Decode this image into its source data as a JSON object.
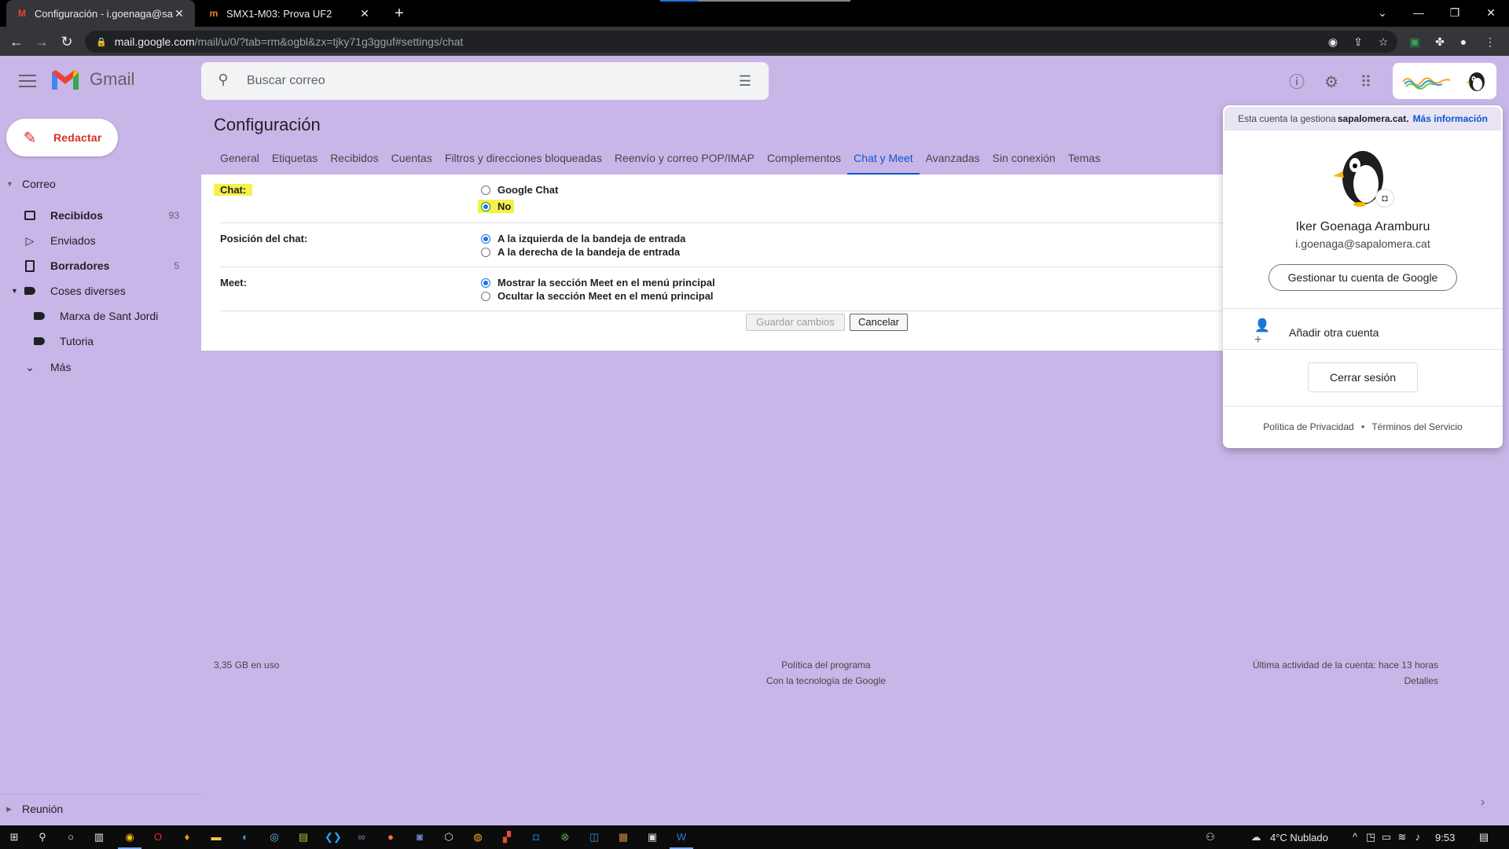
{
  "browser": {
    "tabs": [
      {
        "title": "Configuración - i.goenaga@sapa",
        "active": true
      },
      {
        "title": "SMX1-M03: Prova UF2",
        "active": false
      }
    ],
    "url_host": "mail.google.com",
    "url_path": "/mail/u/0/?tab=rm&ogbl&zx=tjky71g3gguf#settings/chat"
  },
  "gmail": {
    "wordmark": "Gmail",
    "search_placeholder": "Buscar correo"
  },
  "sidebar": {
    "compose": "Redactar",
    "section_mail": "Correo",
    "items": [
      {
        "label": "Recibidos",
        "count": "93",
        "icon": "inbox-icon",
        "bold": true
      },
      {
        "label": "Enviados",
        "count": "",
        "icon": "send-icon",
        "bold": false
      },
      {
        "label": "Borradores",
        "count": "5",
        "icon": "draft-icon",
        "bold": true
      },
      {
        "label": "Coses diverses",
        "count": "",
        "icon": "label-icon",
        "bold": false
      },
      {
        "label": "Marxa de Sant Jordi",
        "count": "",
        "icon": "label-icon",
        "bold": false
      },
      {
        "label": "Tutoria",
        "count": "",
        "icon": "label-icon",
        "bold": false
      },
      {
        "label": "Más",
        "count": "",
        "icon": "chevron-down-icon",
        "bold": false
      }
    ],
    "section_meet": "Reunión"
  },
  "settings": {
    "title": "Configuración",
    "tabs": [
      "General",
      "Etiquetas",
      "Recibidos",
      "Cuentas",
      "Filtros y direcciones bloqueadas",
      "Reenvío y correo POP/IMAP",
      "Complementos",
      "Chat y Meet",
      "Avanzadas",
      "Sin conexión",
      "Temas"
    ],
    "active_tab": "Chat y Meet",
    "chat": {
      "label": "Chat:",
      "opt1": "Google Chat",
      "opt2": "No",
      "selected": "No"
    },
    "position": {
      "label": "Posición del chat:",
      "opt1": "A la izquierda de la bandeja de entrada",
      "opt2": "A la derecha de la bandeja de entrada",
      "selected": "A la izquierda de la bandeja de entrada"
    },
    "meet": {
      "label": "Meet:",
      "opt1": "Mostrar la sección Meet en el menú principal",
      "opt2": "Ocultar la sección Meet en el menú principal",
      "selected": "Mostrar la sección Meet en el menú principal"
    },
    "save": "Guardar cambios",
    "cancel": "Cancelar"
  },
  "footer": {
    "storage": "3,35 GB en uso",
    "policy": "Política del programa",
    "powered": "Con la tecnología de Google",
    "activity": "Última actividad de la cuenta: hace 13 horas",
    "details": "Detalles"
  },
  "account_popover": {
    "managed_prefix": "Esta cuenta la gestiona",
    "managed_org": "sapalomera.cat.",
    "more_info": "Más información",
    "name": "Iker Goenaga Aramburu",
    "email": "i.goenaga@sapalomera.cat",
    "manage": "Gestionar tu cuenta de Google",
    "add_account": "Añadir otra cuenta",
    "sign_out": "Cerrar sesión",
    "privacy": "Política de Privacidad",
    "sep": "•",
    "terms": "Términos del Servicio"
  },
  "taskbar": {
    "weather": "4°C  Nublado",
    "time": "9:53"
  },
  "colors": {
    "background": "#c8b6e8",
    "accent": "#0b57d0",
    "compose_red": "#d93025",
    "highlight": "#f5f14a"
  }
}
